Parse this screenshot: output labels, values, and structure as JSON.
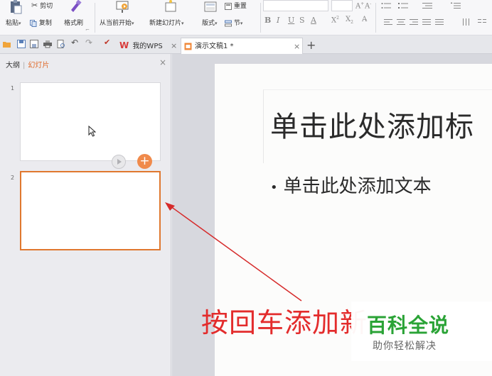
{
  "ribbon": {
    "paste_label": "粘贴",
    "cut_label": "剪切",
    "copy_label": "复制",
    "format_painter_label": "格式刷",
    "from_current_label": "从当前开始",
    "new_slide_label": "新建幻灯片",
    "layout_label": "版式",
    "section_label": "节",
    "reset_label": "重置"
  },
  "tabs": [
    {
      "label": "我的WPS"
    },
    {
      "label": "演示文稿1 *"
    }
  ],
  "left_panel": {
    "tab_outline": "大纲",
    "tab_slides": "幻灯片",
    "slides": [
      {
        "number": "1"
      },
      {
        "number": "2"
      }
    ]
  },
  "slide": {
    "title_placeholder": "单击此处添加标",
    "body_placeholder": "单击此处添加文本"
  },
  "annotation": {
    "text": "按回车添加新",
    "color": "#e32c2c"
  },
  "watermark": {
    "title": "百科全说",
    "subtitle": "助你轻松解决"
  },
  "colors": {
    "accent": "#e06a2a",
    "selected_border": "#e0782f",
    "watermark_green": "#2aa336"
  }
}
